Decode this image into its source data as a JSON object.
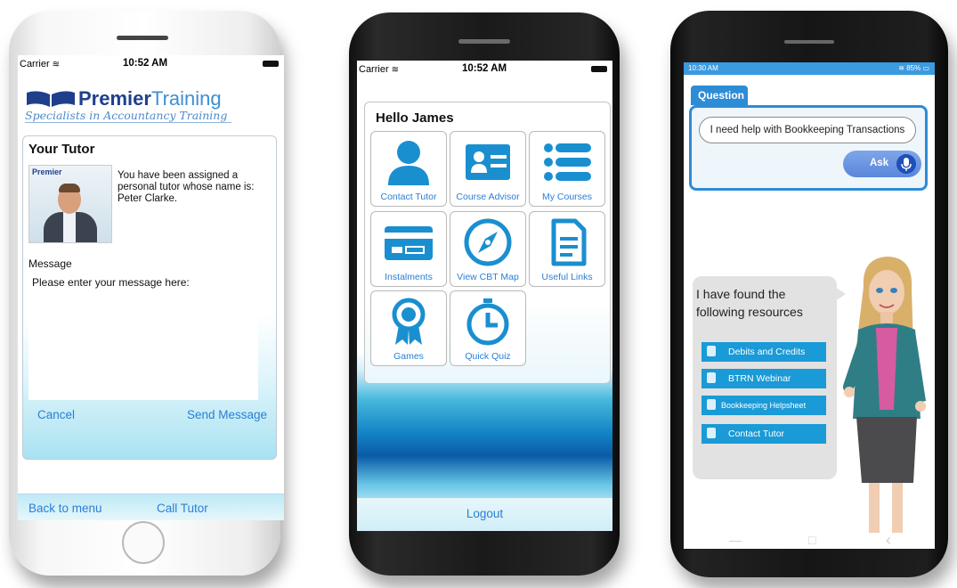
{
  "status_bar": {
    "carrier": "Carrier",
    "time": "10:52 AM"
  },
  "phone1": {
    "brand": {
      "name_bold": "Premier",
      "name_light": "Training",
      "tagline": "Specialists in Accountancy Training"
    },
    "card_title": "Your Tutor",
    "photo_logo": "Premier",
    "description": "You have been assigned a personal tutor whose name is: Peter Clarke.",
    "message_label": "Message",
    "message_placeholder": "Please enter your message here:",
    "cancel_label": "Cancel",
    "send_label": "Send Message",
    "back_label": "Back to menu",
    "call_label": "Call Tutor"
  },
  "phone2": {
    "greeting": "Hello James",
    "tiles": [
      {
        "label": "Contact Tutor",
        "icon": "person-icon"
      },
      {
        "label": "Course Advisor",
        "icon": "id-card-icon"
      },
      {
        "label": "My Courses",
        "icon": "list-icon"
      },
      {
        "label": "Instalments",
        "icon": "credit-card-icon"
      },
      {
        "label": "View CBT Map",
        "icon": "compass-icon"
      },
      {
        "label": "Useful Links",
        "icon": "document-icon"
      },
      {
        "label": "Games",
        "icon": "award-ribbon-icon"
      },
      {
        "label": "Quick Quiz",
        "icon": "stopwatch-icon"
      }
    ],
    "logout_label": "Logout"
  },
  "phone3": {
    "status_time": "10:30 AM",
    "status_right": "85%",
    "question_tab": "Question",
    "question_text": "I need help with Bookkeeping Transactions",
    "ask_label": "Ask",
    "found_text": "I have found the following resources",
    "resources": [
      {
        "label": "Debits and Credits",
        "icon": "video-icon"
      },
      {
        "label": "BTRN Webinar",
        "icon": "webinar-icon"
      },
      {
        "label": "Bookkeeping Helpsheet",
        "icon": "helpsheet-icon"
      },
      {
        "label": "Contact Tutor",
        "icon": "phone-icon"
      }
    ],
    "nav": {
      "home": "□",
      "back": "‹"
    }
  },
  "colors": {
    "ios_link": "#2a7fd6",
    "brand_blue": "#1f3f8c",
    "android_blue": "#2d8cd6",
    "resource_blue": "#1a9ad6"
  }
}
